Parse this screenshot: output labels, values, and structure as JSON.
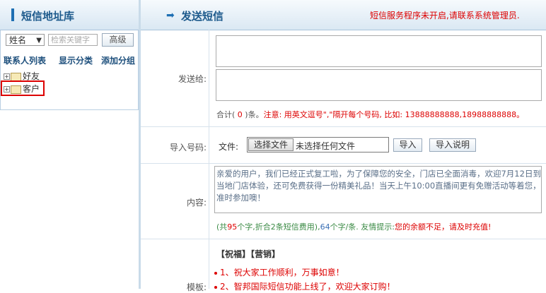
{
  "left": {
    "title": "短信地址库",
    "search_field": "姓名",
    "search_placeholder": "检索关键字",
    "advanced_label": "高级",
    "tabs": [
      "联系人列表",
      "显示分类",
      "添加分组"
    ],
    "tree": [
      {
        "label": "好友",
        "expander": "⊞"
      },
      {
        "label": "客户",
        "expander": "⊞"
      }
    ]
  },
  "right": {
    "title": "发送短信",
    "warning": "短信服务程序未开启,请联系系统管理员.",
    "send_to_label": "发送给:",
    "count_prefix": "合计(",
    "count_value": "0",
    "count_suffix": ")条。",
    "count_note": "注意: 用英文逗号\",\"隔开每个号码, 比如: 13888888888,18988888888。",
    "import_label": "导入号码:",
    "file_label": "文件:",
    "choose_file": "选择文件",
    "no_file": "未选择任何文件",
    "import_button": "导入",
    "import_help_button": "导入说明",
    "content_label": "内容:",
    "content_text": "亲爱的用户，我们已经正式复工啦，为了保障您的安全，门店已全面消毒，欢迎7月12日到当地门店体验，还可免费获得一份精美礼品！当天上午10:00直播间更有免赠活动等着您，准时参加噢！",
    "content_stats_prefix": "(共",
    "content_chars": "95",
    "content_stats_mid": "个字,折合2条短信费用),",
    "content_per": "64",
    "content_stats_mid2": "个字/条. 友情提示:",
    "balance_warning": "您的余额不足，请及时充值!",
    "template_label": "模板:",
    "template_tabs": "【祝福】【营销】",
    "templates": [
      "1、祝大家工作顺利，万事如意！",
      "2、智邦国际短信功能上线了，欢迎大家订购！"
    ]
  },
  "colors": {
    "accent": "#1e6fb3",
    "warning": "#dd0000",
    "highlight": "#dd0000"
  }
}
